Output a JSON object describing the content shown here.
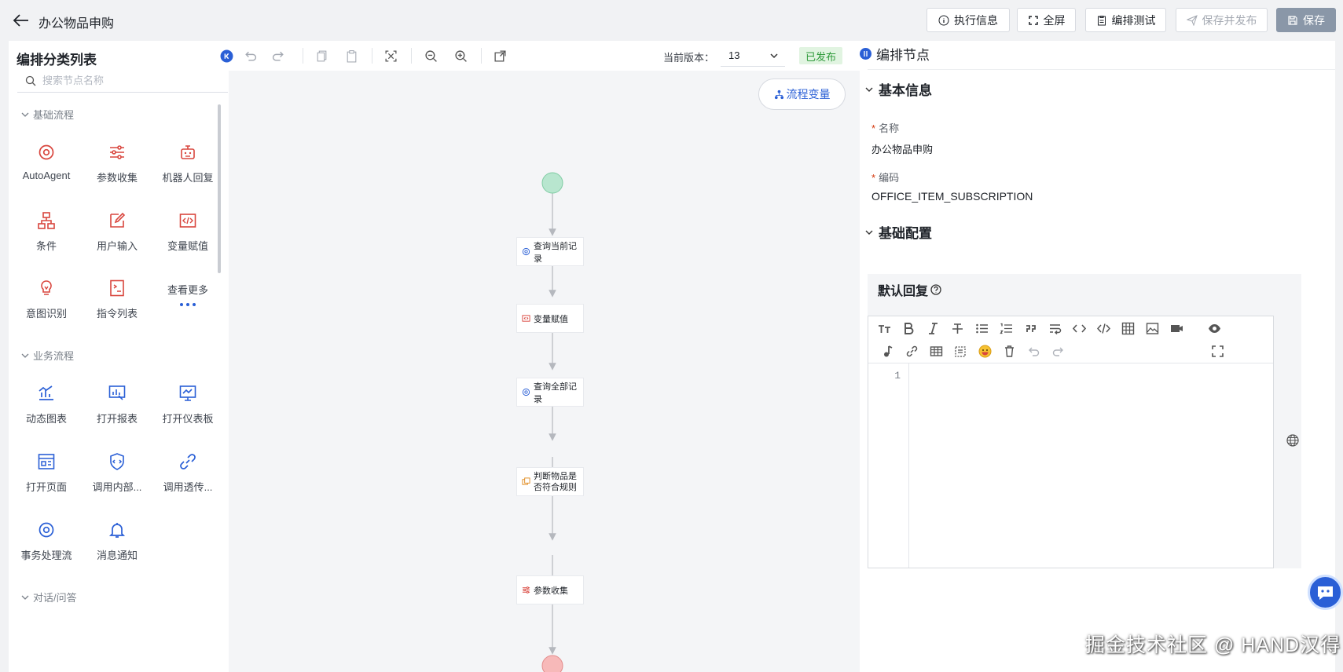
{
  "header": {
    "title": "办公物品申购",
    "buttons": {
      "exec_info": "执行信息",
      "fullscreen": "全屏",
      "test": "编排测试",
      "save_publish": "保存并发布",
      "save": "保存"
    }
  },
  "left_panel": {
    "title": "编排分类列表",
    "search_placeholder": "搜索节点名称",
    "sections": [
      {
        "label": "基础流程",
        "items": [
          {
            "label": "AutoAgent",
            "icon": "target-icon",
            "color": "#d9463e"
          },
          {
            "label": "参数收集",
            "icon": "sliders-icon",
            "color": "#d9463e"
          },
          {
            "label": "机器人回复",
            "icon": "robot-icon",
            "color": "#d9463e"
          },
          {
            "label": "条件",
            "icon": "branch-icon",
            "color": "#d9463e"
          },
          {
            "label": "用户输入",
            "icon": "edit-icon",
            "color": "#d9463e"
          },
          {
            "label": "变量赋值",
            "icon": "code-icon",
            "color": "#d9463e"
          },
          {
            "label": "意图识别",
            "icon": "bulb-icon",
            "color": "#d9463e"
          },
          {
            "label": "指令列表",
            "icon": "command-list-icon",
            "color": "#d9463e"
          },
          {
            "label": "查看更多",
            "icon": "more-icon",
            "color": "#2a5fd6"
          }
        ]
      },
      {
        "label": "业务流程",
        "items": [
          {
            "label": "动态图表",
            "icon": "chart-icon",
            "color": "#2a5fd6"
          },
          {
            "label": "打开报表",
            "icon": "report-icon",
            "color": "#2a5fd6"
          },
          {
            "label": "打开仪表板",
            "icon": "dashboard-icon",
            "color": "#2a5fd6"
          },
          {
            "label": "打开页面",
            "icon": "page-icon",
            "color": "#2a5fd6"
          },
          {
            "label": "调用内部...",
            "icon": "shield-code-icon",
            "color": "#2a5fd6"
          },
          {
            "label": "调用透传...",
            "icon": "link-icon",
            "color": "#2a5fd6"
          },
          {
            "label": "事务处理流",
            "icon": "target-icon",
            "color": "#2a5fd6"
          },
          {
            "label": "消息通知",
            "icon": "bell-icon",
            "color": "#2a5fd6"
          }
        ]
      },
      {
        "label": "对话/问答",
        "items": []
      }
    ]
  },
  "canvas": {
    "version_label": "当前版本：",
    "version_value": "13",
    "status": "已发布",
    "flow_var_button": "流程变量",
    "nodes": [
      {
        "label": "查询当前记录",
        "icon": "target-icon"
      },
      {
        "label": "变量赋值",
        "icon": "code-icon"
      },
      {
        "label": "查询全部记录",
        "icon": "target-icon"
      },
      {
        "label": "判断物品是否符合规则",
        "icon": "condition-icon"
      },
      {
        "label": "参数收集",
        "icon": "sliders-icon"
      }
    ]
  },
  "right_panel": {
    "title": "编排节点",
    "basic_info": {
      "heading": "基本信息",
      "name_label": "名称",
      "name_value": "办公物品申购",
      "code_label": "编码",
      "code_value": "OFFICE_ITEM_SUBSCRIPTION"
    },
    "basic_config": {
      "heading": "基础配置",
      "default_reply": "默认回复",
      "line_number": "1"
    }
  },
  "footer_watermark": "掘金技术社区 @ HAND汉得",
  "colors": {
    "accent": "#2a5fd6",
    "danger": "#d9463e",
    "start_node": "#b8e6cf",
    "end_node": "#f7b9b9",
    "published_bg": "#e1f4e1"
  }
}
